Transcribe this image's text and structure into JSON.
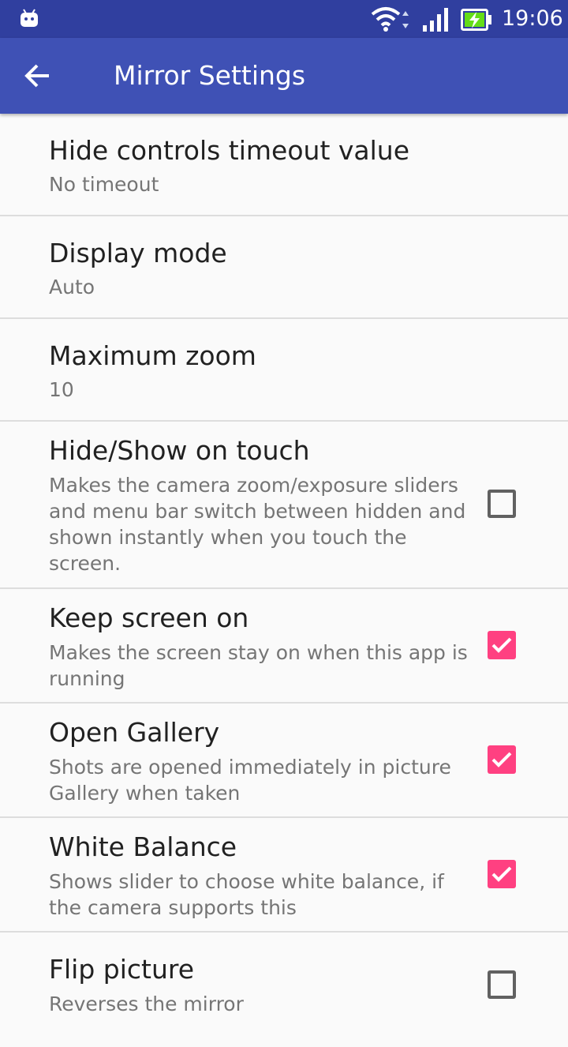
{
  "status_bar": {
    "time": "19:06",
    "icons": [
      "android-icon",
      "wifi-icon",
      "signal-icon",
      "battery-charging-icon"
    ]
  },
  "app_bar": {
    "title": "Mirror Settings",
    "back_icon": "arrow-back-icon"
  },
  "colors": {
    "status_bar": "#303f9f",
    "app_bar": "#3f51b5",
    "checkbox_accent": "#ff4081"
  },
  "preferences": [
    {
      "title": "Hide controls timeout value",
      "summary": "No timeout"
    },
    {
      "title": "Display mode",
      "summary": "Auto"
    },
    {
      "title": "Maximum zoom",
      "summary": "10"
    },
    {
      "title": "Hide/Show on touch",
      "summary": "Makes the camera zoom/exposure sliders and menu bar switch between hidden and shown instantly when you touch the screen.",
      "checked": false
    },
    {
      "title": "Keep screen on",
      "summary": "Makes the screen stay on when this app is running",
      "checked": true
    },
    {
      "title": "Open Gallery",
      "summary": "Shots are opened immediately in picture Gallery when taken",
      "checked": true
    },
    {
      "title": "White Balance",
      "summary": "Shows slider to choose white balance, if the camera supports this",
      "checked": true
    },
    {
      "title": "Flip picture",
      "summary": "Reverses the mirror",
      "checked": false
    }
  ]
}
